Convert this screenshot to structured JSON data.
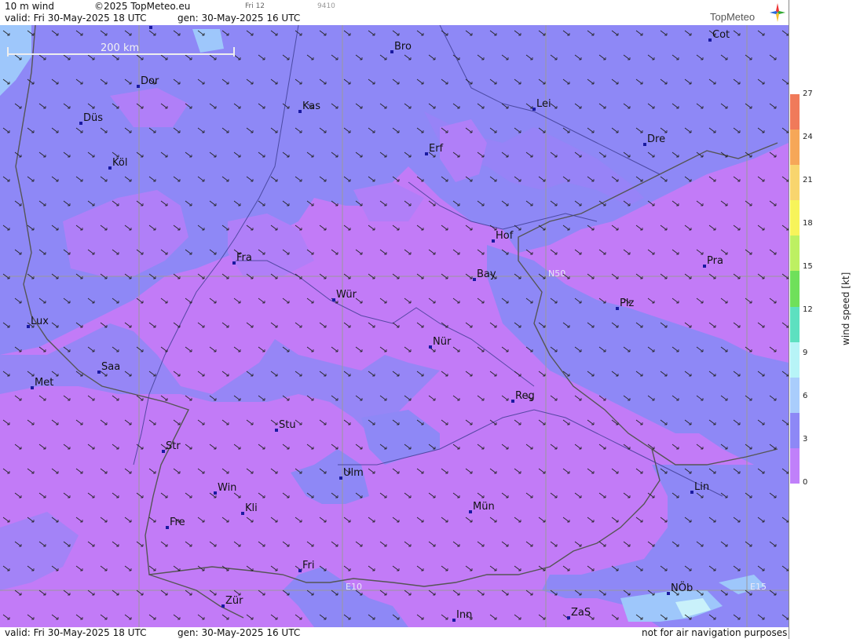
{
  "header": {
    "title": "10 m wind",
    "copyright": "©2025 TopMeteo.eu",
    "valid": "valid:  Fri  30-May-2025  18 UTC",
    "gen": "gen: 30-May-2025 16 UTC",
    "step_day": "Fri 12",
    "step_code": "9410",
    "brand": "TopMeteo"
  },
  "footer": {
    "valid": "valid:  Fri  30-May-2025  18 UTC",
    "gen": "gen: 30-May-2025 16 UTC",
    "disclaimer": "not for air navigation purposes"
  },
  "scale_bar": {
    "label": "200 km"
  },
  "gridlines": {
    "lat": "N50",
    "lon1": "E10",
    "lon2": "E15"
  },
  "legend": {
    "title": "wind speed [kt]",
    "ticks": [
      "27",
      "24",
      "21",
      "18",
      "15",
      "12",
      "9",
      "6",
      "3",
      "0"
    ],
    "colors": [
      "#f07a5a",
      "#f6a758",
      "#f8d56e",
      "#f7f45a",
      "#bdf062",
      "#6fe05a",
      "#5de0c0",
      "#b7f4f7",
      "#a9cdfc",
      "#8d88f6",
      "#c080fa"
    ]
  },
  "cities": [
    {
      "name": "Mün",
      "id": "munster"
    },
    {
      "name": "Bro"
    },
    {
      "name": "Cot"
    },
    {
      "name": "Dor"
    },
    {
      "name": "Kas"
    },
    {
      "name": "Lei"
    },
    {
      "name": "Düs"
    },
    {
      "name": "Erf"
    },
    {
      "name": "Dre"
    },
    {
      "name": "Köl"
    },
    {
      "name": "Hof"
    },
    {
      "name": "Fra"
    },
    {
      "name": "Pra"
    },
    {
      "name": "Bay"
    },
    {
      "name": "Wür"
    },
    {
      "name": "Plz"
    },
    {
      "name": "Lux"
    },
    {
      "name": "Nür"
    },
    {
      "name": "Saa"
    },
    {
      "name": "Met"
    },
    {
      "name": "Reg"
    },
    {
      "name": "Stu"
    },
    {
      "name": "Str"
    },
    {
      "name": "Ulm"
    },
    {
      "name": "Win"
    },
    {
      "name": "Lin"
    },
    {
      "name": "Mün"
    },
    {
      "name": "Kli"
    },
    {
      "name": "Fre"
    },
    {
      "name": "Fri"
    },
    {
      "name": "NÖb"
    },
    {
      "name": "Zür"
    },
    {
      "name": "ZaS"
    },
    {
      "name": "Inn"
    }
  ]
}
